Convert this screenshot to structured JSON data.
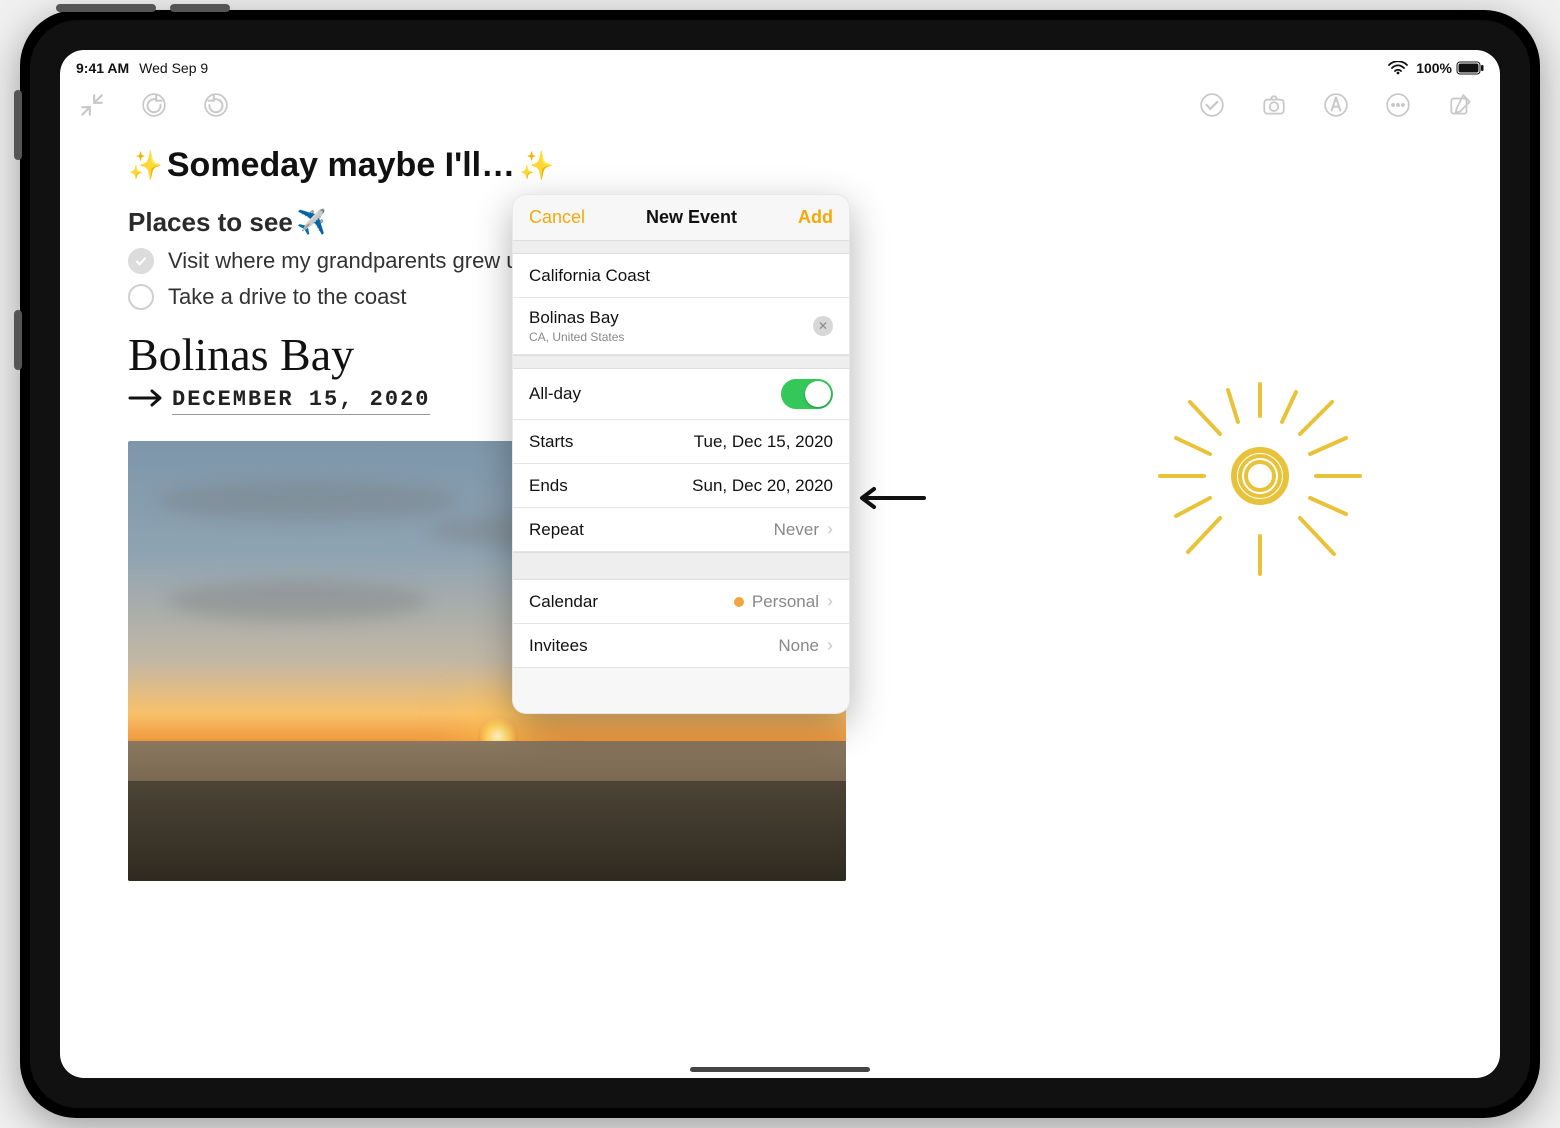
{
  "status": {
    "time": "9:41 AM",
    "date": "Wed Sep 9",
    "battery": "100%"
  },
  "note": {
    "title": "Someday maybe I'll…",
    "section": "Places to see",
    "items": [
      {
        "text": "Visit where my grandparents grew up",
        "done": true
      },
      {
        "text": "Take a drive to the coast",
        "done": false
      }
    ],
    "handwriting_place": "Bolinas Bay",
    "handwriting_date": "DECEMBER 15, 2020"
  },
  "popover": {
    "cancel": "Cancel",
    "title": "New Event",
    "add": "Add",
    "event_title": "California Coast",
    "location": "Bolinas Bay",
    "location_sub": "CA, United States",
    "allday_label": "All-day",
    "allday_on": true,
    "starts_label": "Starts",
    "starts_value": "Tue, Dec 15, 2020",
    "ends_label": "Ends",
    "ends_value": "Sun, Dec 20, 2020",
    "repeat_label": "Repeat",
    "repeat_value": "Never",
    "calendar_label": "Calendar",
    "calendar_value": "Personal",
    "invitees_label": "Invitees",
    "invitees_value": "None"
  }
}
